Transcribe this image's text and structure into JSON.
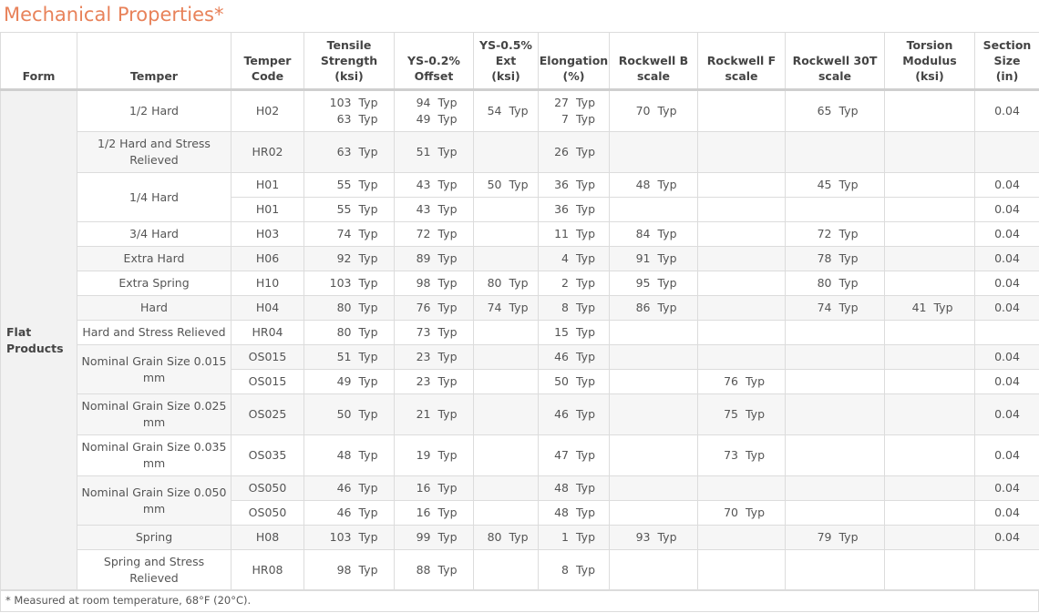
{
  "title": "Mechanical Properties*",
  "accent_color": "#e8825a",
  "headers": {
    "form": "Form",
    "temper": "Temper",
    "temper_code": [
      "Temper",
      "Code"
    ],
    "tensile": [
      "Tensile",
      "Strength",
      "(ksi)"
    ],
    "ys02": [
      "YS-0.2%",
      "Offset"
    ],
    "ys05": [
      "YS-0.5%",
      "Ext",
      "(ksi)"
    ],
    "elongation": [
      "Elongation",
      "(%)"
    ],
    "rockwell_b": [
      "Rockwell B",
      "scale"
    ],
    "rockwell_f": [
      "Rockwell F",
      "scale"
    ],
    "rockwell_30t": [
      "Rockwell 30T",
      "scale"
    ],
    "torsion": [
      "Torsion",
      "Modulus",
      "(ksi)"
    ],
    "section": [
      "Section",
      "Size",
      "(in)"
    ]
  },
  "form_label": [
    "Flat",
    "Products"
  ],
  "typ": "Typ",
  "tempers": [
    [
      "1/2 Hard"
    ],
    [
      "1/2 Hard and Stress",
      "Relieved"
    ],
    [
      "1/4 Hard"
    ],
    [
      "3/4 Hard"
    ],
    [
      "Extra Hard"
    ],
    [
      "Extra Spring"
    ],
    [
      "Hard"
    ],
    [
      "Hard and Stress Relieved"
    ],
    [
      "Nominal Grain Size 0.015",
      "mm"
    ],
    [
      "Nominal Grain Size 0.025",
      "mm"
    ],
    [
      "Nominal Grain Size 0.035",
      "mm"
    ],
    [
      "Nominal Grain Size 0.050",
      "mm"
    ],
    [
      "Spring"
    ],
    [
      "Spring and Stress",
      "Relieved"
    ]
  ],
  "rows": [
    {
      "code": "H02",
      "tensile": [
        "103",
        "63"
      ],
      "ys02": [
        "94",
        "49"
      ],
      "ys05": [
        "54"
      ],
      "elong": [
        "27",
        "7"
      ],
      "rb": [
        "70"
      ],
      "rf": [],
      "r30t": [
        "65"
      ],
      "torsion": [],
      "section": "0.04"
    },
    {
      "code": "HR02",
      "tensile": [
        "63"
      ],
      "ys02": [
        "51"
      ],
      "ys05": [],
      "elong": [
        "26"
      ],
      "rb": [],
      "rf": [],
      "r30t": [],
      "torsion": [],
      "section": ""
    },
    {
      "code": "H01",
      "tensile": [
        "55"
      ],
      "ys02": [
        "43"
      ],
      "ys05": [
        "50"
      ],
      "elong": [
        "36"
      ],
      "rb": [
        "48"
      ],
      "rf": [],
      "r30t": [
        "45"
      ],
      "torsion": [],
      "section": "0.04"
    },
    {
      "code": "H01",
      "tensile": [
        "55"
      ],
      "ys02": [
        "43"
      ],
      "ys05": [],
      "elong": [
        "36"
      ],
      "rb": [],
      "rf": [],
      "r30t": [],
      "torsion": [],
      "section": "0.04"
    },
    {
      "code": "H03",
      "tensile": [
        "74"
      ],
      "ys02": [
        "72"
      ],
      "ys05": [],
      "elong": [
        "11"
      ],
      "rb": [
        "84"
      ],
      "rf": [],
      "r30t": [
        "72"
      ],
      "torsion": [],
      "section": "0.04"
    },
    {
      "code": "H06",
      "tensile": [
        "92"
      ],
      "ys02": [
        "89"
      ],
      "ys05": [],
      "elong": [
        "4"
      ],
      "rb": [
        "91"
      ],
      "rf": [],
      "r30t": [
        "78"
      ],
      "torsion": [],
      "section": "0.04"
    },
    {
      "code": "H10",
      "tensile": [
        "103"
      ],
      "ys02": [
        "98"
      ],
      "ys05": [
        "80"
      ],
      "elong": [
        "2"
      ],
      "rb": [
        "95"
      ],
      "rf": [],
      "r30t": [
        "80"
      ],
      "torsion": [],
      "section": "0.04"
    },
    {
      "code": "H04",
      "tensile": [
        "80"
      ],
      "ys02": [
        "76"
      ],
      "ys05": [
        "74"
      ],
      "elong": [
        "8"
      ],
      "rb": [
        "86"
      ],
      "rf": [],
      "r30t": [
        "74"
      ],
      "torsion": [
        "41"
      ],
      "section": "0.04"
    },
    {
      "code": "HR04",
      "tensile": [
        "80"
      ],
      "ys02": [
        "73"
      ],
      "ys05": [],
      "elong": [
        "15"
      ],
      "rb": [],
      "rf": [],
      "r30t": [],
      "torsion": [],
      "section": ""
    },
    {
      "code": "OS015",
      "tensile": [
        "51"
      ],
      "ys02": [
        "23"
      ],
      "ys05": [],
      "elong": [
        "46"
      ],
      "rb": [],
      "rf": [],
      "r30t": [],
      "torsion": [],
      "section": "0.04"
    },
    {
      "code": "OS015",
      "tensile": [
        "49"
      ],
      "ys02": [
        "23"
      ],
      "ys05": [],
      "elong": [
        "50"
      ],
      "rb": [],
      "rf": [
        "76"
      ],
      "r30t": [],
      "torsion": [],
      "section": "0.04"
    },
    {
      "code": "OS025",
      "tensile": [
        "50"
      ],
      "ys02": [
        "21"
      ],
      "ys05": [],
      "elong": [
        "46"
      ],
      "rb": [],
      "rf": [
        "75"
      ],
      "r30t": [],
      "torsion": [],
      "section": "0.04"
    },
    {
      "code": "OS035",
      "tensile": [
        "48"
      ],
      "ys02": [
        "19"
      ],
      "ys05": [],
      "elong": [
        "47"
      ],
      "rb": [],
      "rf": [
        "73"
      ],
      "r30t": [],
      "torsion": [],
      "section": "0.04"
    },
    {
      "code": "OS050",
      "tensile": [
        "46"
      ],
      "ys02": [
        "16"
      ],
      "ys05": [],
      "elong": [
        "48"
      ],
      "rb": [],
      "rf": [],
      "r30t": [],
      "torsion": [],
      "section": "0.04"
    },
    {
      "code": "OS050",
      "tensile": [
        "46"
      ],
      "ys02": [
        "16"
      ],
      "ys05": [],
      "elong": [
        "48"
      ],
      "rb": [],
      "rf": [
        "70"
      ],
      "r30t": [],
      "torsion": [],
      "section": "0.04"
    },
    {
      "code": "H08",
      "tensile": [
        "103"
      ],
      "ys02": [
        "99"
      ],
      "ys05": [
        "80"
      ],
      "elong": [
        "1"
      ],
      "rb": [
        "93"
      ],
      "rf": [],
      "r30t": [
        "79"
      ],
      "torsion": [],
      "section": "0.04"
    },
    {
      "code": "HR08",
      "tensile": [
        "98"
      ],
      "ys02": [
        "88"
      ],
      "ys05": [],
      "elong": [
        "8"
      ],
      "rb": [],
      "rf": [],
      "r30t": [],
      "torsion": [],
      "section": ""
    }
  ],
  "footnote": "* Measured at room temperature, 68°F (20°C)."
}
